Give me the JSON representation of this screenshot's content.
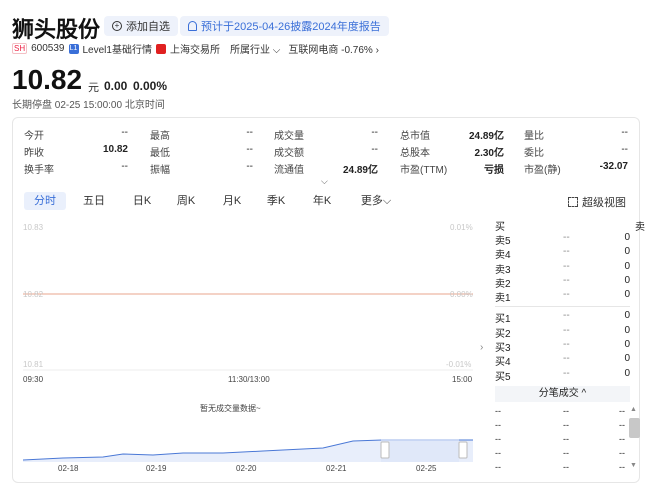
{
  "header": {
    "name": "狮头股份",
    "add_watch": "添加自选",
    "notice": "预计于2025-04-26披露2024年度报告",
    "exchange_tag": "SH",
    "code": "600539",
    "level_tag": "L1",
    "level_text": "Level1基础行情",
    "exchange_name": "上海交易所",
    "industry_label": "所属行业",
    "industry_value": "互联网电商 -0.76%"
  },
  "quote": {
    "price": "10.82",
    "unit": "元",
    "change": "0.00",
    "change_pct": "0.00%",
    "status": "长期停盘 02-25 15:00:00 北京时间"
  },
  "stats": [
    {
      "label": "今开",
      "value": "--"
    },
    {
      "label": "最高",
      "value": "--"
    },
    {
      "label": "成交量",
      "value": "--"
    },
    {
      "label": "总市值",
      "value": "24.89亿"
    },
    {
      "label": "量比",
      "value": "--"
    },
    {
      "label": "昨收",
      "value": "10.82"
    },
    {
      "label": "最低",
      "value": "--"
    },
    {
      "label": "成交额",
      "value": "--"
    },
    {
      "label": "总股本",
      "value": "2.30亿"
    },
    {
      "label": "委比",
      "value": "--"
    },
    {
      "label": "换手率",
      "value": "--"
    },
    {
      "label": "振幅",
      "value": "--"
    },
    {
      "label": "流通值",
      "value": "24.89亿"
    },
    {
      "label": "市盈(TTM)",
      "value": "亏损"
    },
    {
      "label": "市盈(静)",
      "value": "-32.07"
    }
  ],
  "tabs": [
    "分时",
    "五日",
    "日K",
    "周K",
    "月K",
    "季K",
    "年K",
    "更多"
  ],
  "super_view": "超级视图",
  "chart": {
    "price_top": "10.83",
    "price_mid": "10.82",
    "price_bottom": "10.81",
    "pct_top": "0.01%",
    "pct_mid": "0.00%",
    "pct_bottom": "-0.01%",
    "time_start": "09:30",
    "time_mid": "11:30/13:00",
    "time_end": "15:00",
    "no_volume": "暂无成交量数据~"
  },
  "orderbook": {
    "buy_label": "买",
    "sell_label": "卖",
    "asks": [
      {
        "name": "卖5",
        "price": "--",
        "qty": "0"
      },
      {
        "name": "卖4",
        "price": "--",
        "qty": "0"
      },
      {
        "name": "卖3",
        "price": "--",
        "qty": "0"
      },
      {
        "name": "卖2",
        "price": "--",
        "qty": "0"
      },
      {
        "name": "卖1",
        "price": "--",
        "qty": "0"
      }
    ],
    "bids": [
      {
        "name": "买1",
        "price": "--",
        "qty": "0"
      },
      {
        "name": "买2",
        "price": "--",
        "qty": "0"
      },
      {
        "name": "买3",
        "price": "--",
        "qty": "0"
      },
      {
        "name": "买4",
        "price": "--",
        "qty": "0"
      },
      {
        "name": "买5",
        "price": "--",
        "qty": "0"
      }
    ]
  },
  "ticks": {
    "header": "分笔成交",
    "rows": [
      [
        "--",
        "--",
        "--"
      ],
      [
        "--",
        "--",
        "--"
      ],
      [
        "--",
        "--",
        "--"
      ],
      [
        "--",
        "--",
        "--"
      ],
      [
        "--",
        "--",
        "--"
      ]
    ]
  },
  "mini_chart_dates": [
    "02-18",
    "02-19",
    "02-20",
    "02-21",
    "02-25"
  ],
  "colors": {
    "accent": "#3a6fd8",
    "price_line": "#e8a48c",
    "mini_fill": "#e8eefb",
    "mini_line": "#4a78d6"
  }
}
